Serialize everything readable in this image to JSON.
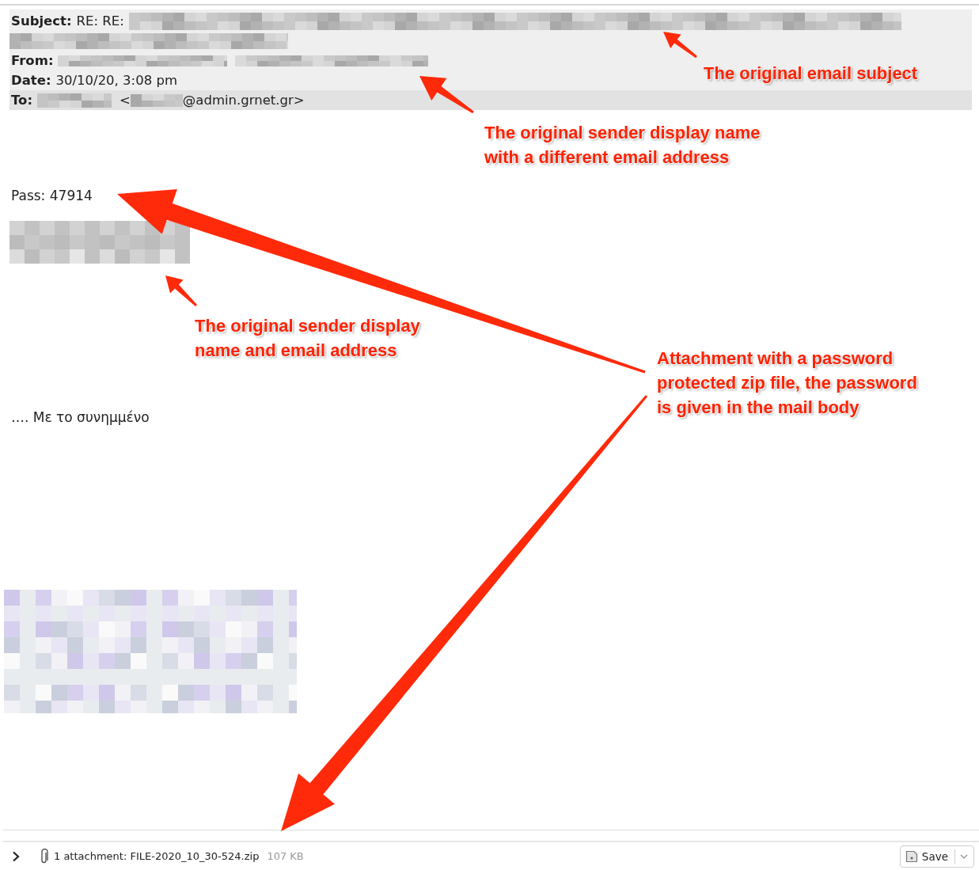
{
  "header": {
    "subject": {
      "label": "Subject:",
      "value": "RE: RE:"
    },
    "from": {
      "label": "From:"
    },
    "date": {
      "label": "Date:",
      "value": "30/10/20, 3:08 pm"
    },
    "to": {
      "label": "To:",
      "prefix": "<",
      "suffix": "@admin.grnet.gr>"
    }
  },
  "body": {
    "password_line": "Pass: 47914",
    "attachment_line": "…. Με το συνημμένο"
  },
  "attachment_bar": {
    "summary": "1 attachment: FILE-2020_10_30-524.zip",
    "size": "107 KB",
    "save_button": "Save"
  },
  "annotations": [
    {
      "lines": [
        "The original email subject"
      ]
    },
    {
      "lines": [
        "The original sender display name",
        "with a different email address"
      ]
    },
    {
      "lines": [
        "The original sender display",
        "name and email address"
      ]
    },
    {
      "lines": [
        "Attachment with a password",
        "protected zip file, the password",
        "is given in the mail body"
      ]
    }
  ]
}
